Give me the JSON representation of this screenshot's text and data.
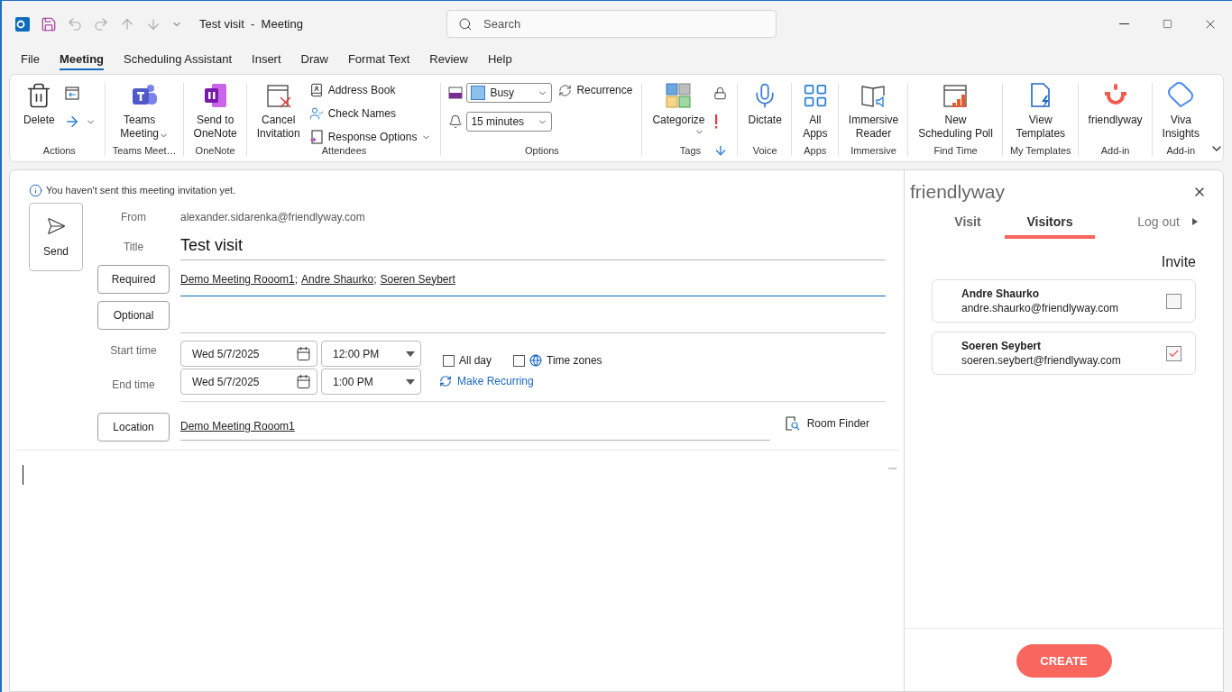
{
  "titlebar": {
    "title": "Test visit  -  Meeting",
    "search_placeholder": "Search"
  },
  "quick_access": [
    {
      "disabled": false
    },
    {
      "disabled": true
    },
    {
      "disabled": true
    },
    {
      "disabled": true
    },
    {
      "disabled": true
    }
  ],
  "menu": [
    {
      "label": "File",
      "selected": false
    },
    {
      "label": "Meeting",
      "selected": true
    },
    {
      "label": "Scheduling Assistant",
      "selected": false
    },
    {
      "label": "Insert",
      "selected": false
    },
    {
      "label": "Draw",
      "selected": false
    },
    {
      "label": "Format Text",
      "selected": false
    },
    {
      "label": "Review",
      "selected": false
    },
    {
      "label": "Help",
      "selected": false
    }
  ],
  "ribbon": [
    {
      "label": "Actions",
      "items": [
        {
          "kind": "large",
          "label": "Delete"
        },
        {
          "kind": "column",
          "items": [
            {
              "kind": "icon"
            },
            {
              "kind": "icon",
              "dropdown": true
            }
          ]
        }
      ]
    },
    {
      "label": "Teams Meet…",
      "items": [
        {
          "kind": "large",
          "label": "Teams\nMeeting",
          "dropdown": true
        }
      ]
    },
    {
      "label": "OneNote",
      "items": [
        {
          "kind": "large",
          "label": "Send to\nOneNote"
        }
      ]
    },
    {
      "label": "Attendees",
      "items": [
        {
          "kind": "large",
          "label": "Cancel\nInvitation"
        },
        {
          "kind": "column",
          "items": [
            {
              "kind": "small",
              "label": "Address Book"
            },
            {
              "kind": "small",
              "label": "Check Names"
            },
            {
              "kind": "small",
              "label": "Response Options",
              "dropdown": true
            }
          ]
        }
      ]
    },
    {
      "label": "Options",
      "items": [
        {
          "kind": "column",
          "items": [
            {
              "kind": "select",
              "label": "Busy"
            },
            {
              "kind": "select",
              "label": "15 minutes"
            }
          ]
        },
        {
          "kind": "column",
          "items": [
            {
              "kind": "small",
              "label": "Recurrence"
            }
          ]
        }
      ]
    },
    {
      "label": "Tags",
      "items": [
        {
          "kind": "large",
          "label": "Categorize",
          "dropdown": true
        },
        {
          "kind": "column",
          "items": [
            {
              "kind": "icon"
            },
            {
              "kind": "icon"
            },
            {
              "kind": "icon"
            }
          ]
        }
      ]
    },
    {
      "label": "Voice",
      "items": [
        {
          "kind": "large",
          "label": "Dictate"
        }
      ]
    },
    {
      "label": "Apps",
      "items": [
        {
          "kind": "large",
          "label": "All\nApps"
        }
      ]
    },
    {
      "label": "Immersive",
      "items": [
        {
          "kind": "large",
          "label": "Immersive\nReader"
        }
      ]
    },
    {
      "label": "Find Time",
      "items": [
        {
          "kind": "large",
          "label": "New\nScheduling Poll"
        }
      ]
    },
    {
      "label": "My Templates",
      "items": [
        {
          "kind": "large",
          "label": "View\nTemplates"
        }
      ]
    },
    {
      "label": "Add-in",
      "items": [
        {
          "kind": "large",
          "label": "friendlyway"
        }
      ]
    },
    {
      "label": "Add-in",
      "items": [
        {
          "kind": "large",
          "label": "Viva\nInsights"
        }
      ]
    }
  ],
  "form": {
    "notice": "You haven't sent this meeting invitation yet.",
    "send": "Send",
    "from": {
      "label": "From",
      "value": "alexander.sidarenka@friendlyway.com"
    },
    "title": {
      "label": "Title",
      "value": "Test visit"
    },
    "required": {
      "button": "Required",
      "recipients": [
        "Demo Meeting Rooom1",
        "Andre Shaurko",
        "Soeren Seybert"
      ],
      "separator": ";"
    },
    "optional": {
      "button": "Optional"
    },
    "start": {
      "label": "Start time",
      "date": "Wed 5/7/2025",
      "time": "12:00 PM"
    },
    "end": {
      "label": "End time",
      "date": "Wed 5/7/2025",
      "time": "1:00 PM"
    },
    "all_day": {
      "label": "All day",
      "checked": false
    },
    "time_zones": {
      "label": "Time zones",
      "checked": false
    },
    "make_recurring": "Make Recurring",
    "location": {
      "button": "Location",
      "value": "Demo Meeting Rooom1",
      "room_finder": "Room Finder"
    }
  },
  "panel": {
    "title": "friendlyway",
    "tabs": [
      {
        "label": "Visit",
        "selected": false
      },
      {
        "label": "Visitors",
        "selected": true
      }
    ],
    "logout": "Log out",
    "invite_label": "Invite",
    "visitors": [
      {
        "name": "Andre Shaurko",
        "email": "andre.shaurko@friendlyway.com",
        "checked": false
      },
      {
        "name": "Soeren Seybert",
        "email": "soeren.seybert@friendlyway.com",
        "checked": true
      }
    ],
    "create": "CREATE"
  }
}
